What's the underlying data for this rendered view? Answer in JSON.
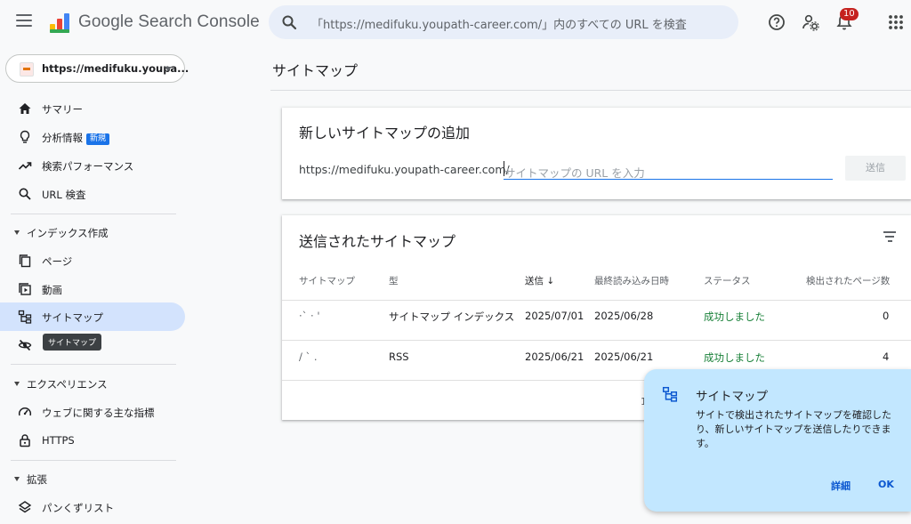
{
  "header": {
    "brand": "Google Search Console",
    "search_placeholder": "「https://medifuku.youpath-career.com/」内のすべての URL を検査",
    "notification_count": "10"
  },
  "property": {
    "label": "https://medifuku.youpa..."
  },
  "sidebar": {
    "items": [
      {
        "label": "サマリー",
        "icon": "home-icon"
      },
      {
        "label": "分析情報",
        "icon": "lightbulb-icon",
        "badge": "新規"
      },
      {
        "label": "検索パフォーマンス",
        "icon": "trending-up-icon"
      },
      {
        "label": "URL 検査",
        "icon": "search-icon"
      }
    ],
    "index_section": {
      "title": "インデックス作成",
      "items": [
        {
          "label": "ページ",
          "icon": "pages-icon"
        },
        {
          "label": "動画",
          "icon": "video-icon"
        },
        {
          "label": "サイトマップ",
          "icon": "sitemap-icon",
          "active": true
        },
        {
          "label": "",
          "icon": "removals-icon"
        }
      ]
    },
    "tooltip": "サイトマップ",
    "experience_section": {
      "title": "エクスペリエンス",
      "items": [
        {
          "label": "ウェブに関する主な指標",
          "icon": "gauge-icon"
        },
        {
          "label": "HTTPS",
          "icon": "lock-icon"
        }
      ]
    },
    "enhancements_section": {
      "title": "拡張",
      "items": [
        {
          "label": "パンくずリスト",
          "icon": "layers-icon"
        }
      ]
    }
  },
  "main": {
    "title": "サイトマップ",
    "add_card": {
      "title": "新しいサイトマップの追加",
      "prefix": "https://medifuku.youpath-career.com/",
      "input_placeholder": "サイトマップの URL を入力",
      "submit_label": "送信"
    },
    "submitted_card": {
      "title": "送信されたサイトマップ",
      "columns": [
        "サイトマップ",
        "型",
        "送信",
        "最終読み込み日時",
        "ステータス",
        "検出されたページ数"
      ],
      "rows": [
        {
          "sitemap": "·` ·    '",
          "type": "サイトマップ インデックス",
          "submitted": "2025/07/01",
          "last_read": "2025/06/28",
          "status": "成功しました",
          "pages": "0"
        },
        {
          "sitemap": "/ `    .",
          "type": "RSS",
          "submitted": "2025/06/21",
          "last_read": "2025/06/21",
          "status": "成功しました",
          "pages": "4"
        }
      ],
      "pager": "1"
    }
  },
  "popup": {
    "title": "サイトマップ",
    "description": "サイトで検出されたサイトマップを確認したり、新しいサイトマップを送信したりできます。",
    "details_label": "詳細",
    "ok_label": "OK"
  },
  "colors": {
    "accent": "#1a73e8",
    "active_bg": "#d3e3fd",
    "success": "#188038",
    "popup_bg": "#c2e7ff"
  }
}
